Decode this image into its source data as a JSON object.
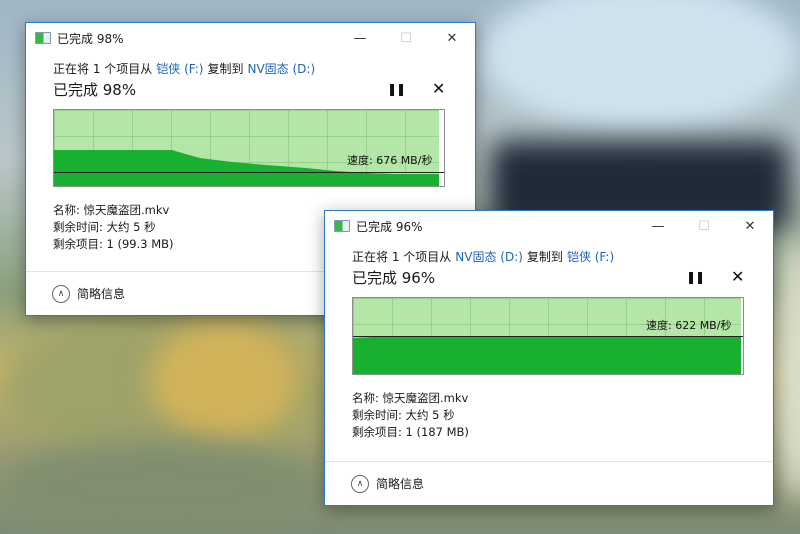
{
  "colors": {
    "accent": "#2b79c9",
    "graph_fill": "#18b030",
    "graph_bg": "#b4e6a8",
    "link": "#1a64b8"
  },
  "dialog1": {
    "title": "已完成 98%",
    "copy_prefix": "正在将 1 个项目从",
    "source": "铠侠 (F:)",
    "copy_mid": "复制到",
    "dest": "NV固态 (D:)",
    "status": "已完成 98%",
    "progress_percent": 98,
    "speed_label": "速度: 676 MB/秒",
    "name": "名称: 惊天魔盗团.mkv",
    "time_left": "剩余时间: 大约 5 秒",
    "items_left": "剩余项目: 1 (99.3 MB)",
    "footer": "简略信息",
    "icons": {
      "minimize": "minimize-icon",
      "maximize": "maximize-icon",
      "close": "close-icon",
      "pause": "pause-icon",
      "cancel": "cancel-icon",
      "collapse": "chevron-up-icon"
    }
  },
  "dialog2": {
    "title": "已完成 96%",
    "copy_prefix": "正在将 1 个项目从",
    "source": "NV固态 (D:)",
    "copy_mid": "复制到",
    "dest": "铠侠 (F:)",
    "status": "已完成 96%",
    "progress_percent": 96,
    "speed_label": "速度: 622 MB/秒",
    "name": "名称: 惊天魔盗团.mkv",
    "time_left": "剩余时间: 大约 5 秒",
    "items_left": "剩余项目: 1 (187 MB)",
    "footer": "简略信息",
    "icons": {
      "minimize": "minimize-icon",
      "maximize": "maximize-icon",
      "close": "close-icon",
      "pause": "pause-icon",
      "cancel": "cancel-icon",
      "collapse": "chevron-up-icon"
    }
  }
}
